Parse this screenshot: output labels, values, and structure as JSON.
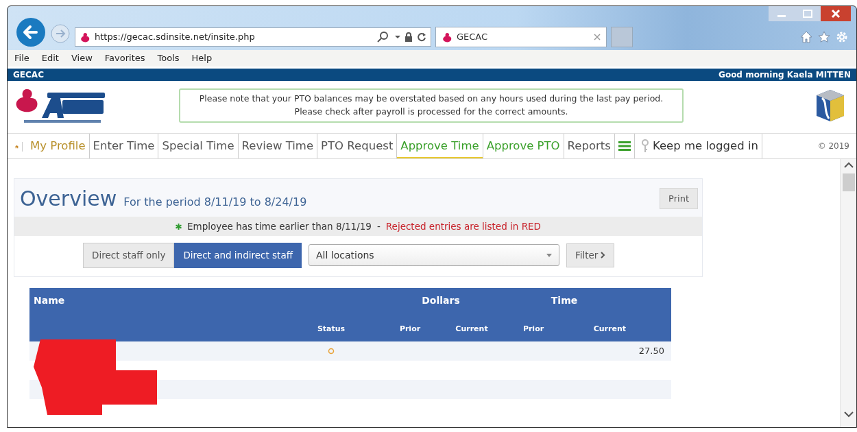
{
  "browser": {
    "url": "https://gecac.sdinsite.net/insite.php",
    "tab_title": "GECAC",
    "menu": [
      "File",
      "Edit",
      "View",
      "Favorites",
      "Tools",
      "Help"
    ]
  },
  "site": {
    "org": "GECAC",
    "greeting": "Good morning Kaela MITTEN",
    "notice": "Please note that your PTO balances may be overstated based on any hours used during the last pay period.  Please check after payroll is processed for the correct amounts.",
    "copyright": "© 2019",
    "keep_logged_in": "Keep me logged in"
  },
  "nav": [
    {
      "label": "My Profile",
      "color": "#b8902a",
      "selected": false
    },
    {
      "label": "Enter Time",
      "color": "#555555",
      "selected": false
    },
    {
      "label": "Special Time",
      "color": "#555555",
      "selected": false
    },
    {
      "label": "Review Time",
      "color": "#555555",
      "selected": false
    },
    {
      "label": "PTO Request",
      "color": "#555555",
      "selected": false
    },
    {
      "label": "Approve Time",
      "color": "#3aa02a",
      "selected": true
    },
    {
      "label": "Approve PTO",
      "color": "#3aa02a",
      "selected": false
    },
    {
      "label": "Reports",
      "color": "#555555",
      "selected": false
    }
  ],
  "overview": {
    "title": "Overview",
    "period": "For the period 8/11/19 to 8/24/19",
    "print": "Print",
    "note": "Employee has time earlier than 8/11/19",
    "note_sep": "-",
    "rejected_note": "Rejected entries are listed in RED",
    "staff_toggle": [
      {
        "label": "Direct staff only",
        "selected": false
      },
      {
        "label": "Direct and indirect staff",
        "selected": true
      }
    ],
    "location": "All locations",
    "filter": "Filter"
  },
  "table": {
    "group_headers": [
      "Name",
      "Dollars",
      "Time"
    ],
    "columns": [
      "Status",
      "Prior",
      "Current",
      "Prior",
      "Current"
    ],
    "names_redacted": true,
    "rows": [
      {
        "status_icon": true,
        "time_current": "27.50"
      }
    ]
  }
}
